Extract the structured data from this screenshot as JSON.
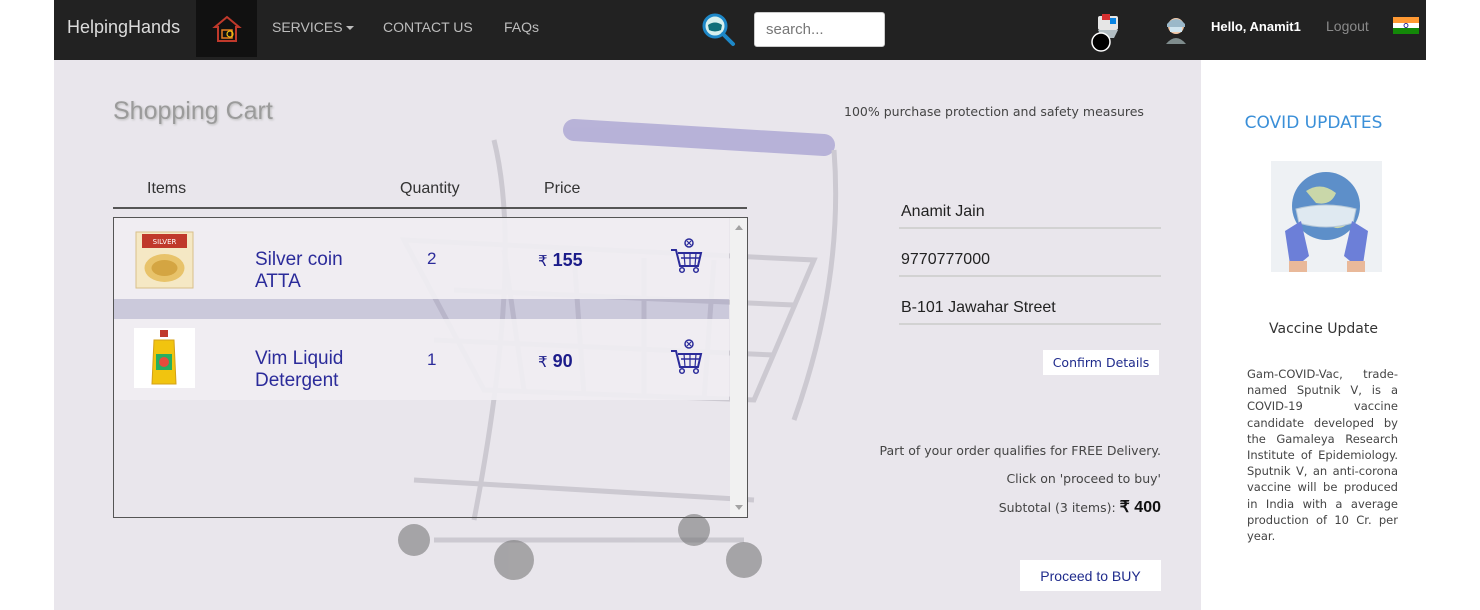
{
  "navbar": {
    "brand": "HelpingHands",
    "links": [
      {
        "label": "SERVICES",
        "has_caret": true
      },
      {
        "label": "CONTACT US"
      },
      {
        "label": "FAQs"
      }
    ],
    "search_placeholder": "search...",
    "greeting": "Hello, Anamit1",
    "logout": "Logout",
    "bg_color": "#222222"
  },
  "cart": {
    "title": "Shopping Cart",
    "protection_note": "100% purchase protection and safety measures",
    "columns": [
      "Items",
      "Quantity",
      "Price"
    ],
    "currency": "₹",
    "items": [
      {
        "name_line1": "Silver coin",
        "name_line2": "ATTA",
        "quantity": "2",
        "price": "155",
        "thumb": "atta-pack-icon"
      },
      {
        "name_line1": "Vim Liquid",
        "name_line2": "Detergent",
        "quantity": "1",
        "price": "90",
        "thumb": "detergent-bottle-icon"
      }
    ]
  },
  "details": {
    "name": "Anamit Jain",
    "phone": "9770777000",
    "address": "B-101 Jawahar Street",
    "confirm_label": "Confirm Details"
  },
  "order": {
    "free_delivery": "Part of your order qualifies for FREE Delivery.",
    "proceed_hint": "Click on 'proceed to buy'",
    "subtotal_label": "Subtotal (3 items):",
    "subtotal_value": "₹ 400",
    "buy_label": "Proceed to BUY"
  },
  "sidebar": {
    "title": "COVID UPDATES",
    "vaccine_title": "Vaccine Update",
    "vaccine_text": "Gam-COVID-Vac, trade-named Sputnik V, is a COVID-19 vaccine candidate developed by the Gamaleya Research Institute of Epidemiology. Sputnik V, an anti-corona vaccine will be produced in India with a average production of 10 Cr. per year."
  },
  "colors": {
    "accent_blue": "#3a8fd8",
    "text_navy": "#2b2b9a",
    "main_bg": "#e9e6ec"
  }
}
